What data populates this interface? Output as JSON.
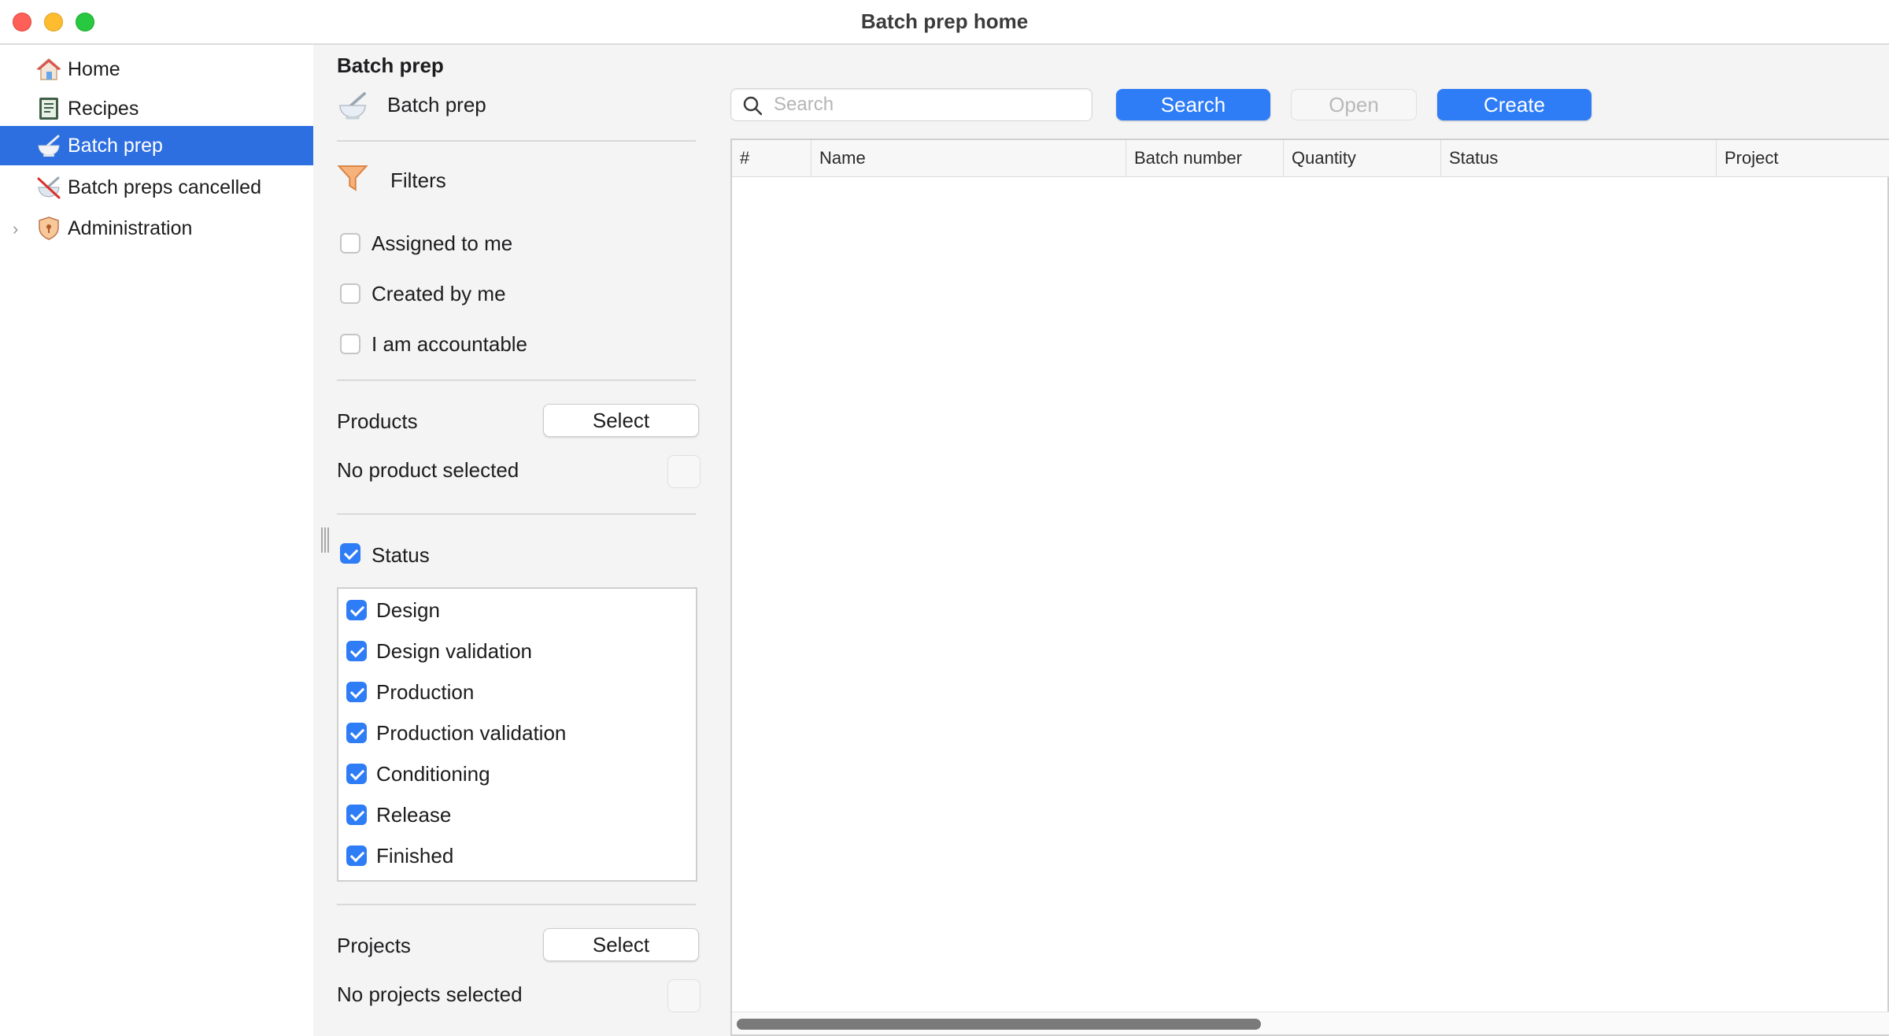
{
  "window": {
    "title": "Batch prep home"
  },
  "sidebar": {
    "items": [
      {
        "label": "Home",
        "icon": "home-icon"
      },
      {
        "label": "Recipes",
        "icon": "recipe-book-icon"
      },
      {
        "label": "Batch prep",
        "icon": "mortar-icon",
        "selected": true
      },
      {
        "label": "Batch preps cancelled",
        "icon": "mortar-cancelled-icon"
      },
      {
        "label": "Administration",
        "icon": "shield-icon",
        "expandable": true
      }
    ]
  },
  "filters": {
    "section_title": "Batch prep",
    "header_label": "Batch prep",
    "filters_label": "Filters",
    "checkboxes": [
      {
        "label": "Assigned to me",
        "checked": false
      },
      {
        "label": "Created by me",
        "checked": false
      },
      {
        "label": "I am accountable",
        "checked": false
      }
    ],
    "products": {
      "label": "Products",
      "select_label": "Select",
      "empty_text": "No product selected"
    },
    "status": {
      "label": "Status",
      "checked": true,
      "options": [
        {
          "label": "Design",
          "checked": true
        },
        {
          "label": "Design validation",
          "checked": true
        },
        {
          "label": "Production",
          "checked": true
        },
        {
          "label": "Production validation",
          "checked": true
        },
        {
          "label": "Conditioning",
          "checked": true
        },
        {
          "label": "Release",
          "checked": true
        },
        {
          "label": "Finished",
          "checked": true
        }
      ]
    },
    "projects": {
      "label": "Projects",
      "select_label": "Select",
      "empty_text": "No projects selected"
    }
  },
  "toolbar": {
    "search_placeholder": "Search",
    "search_value": "",
    "search_button": "Search",
    "open_button": "Open",
    "create_button": "Create"
  },
  "table": {
    "columns": [
      "#",
      "Name",
      "Batch number",
      "Quantity",
      "Status",
      "Project"
    ],
    "rows": []
  },
  "colors": {
    "accent": "#2e7cf6",
    "selection": "#2d6ee0"
  }
}
